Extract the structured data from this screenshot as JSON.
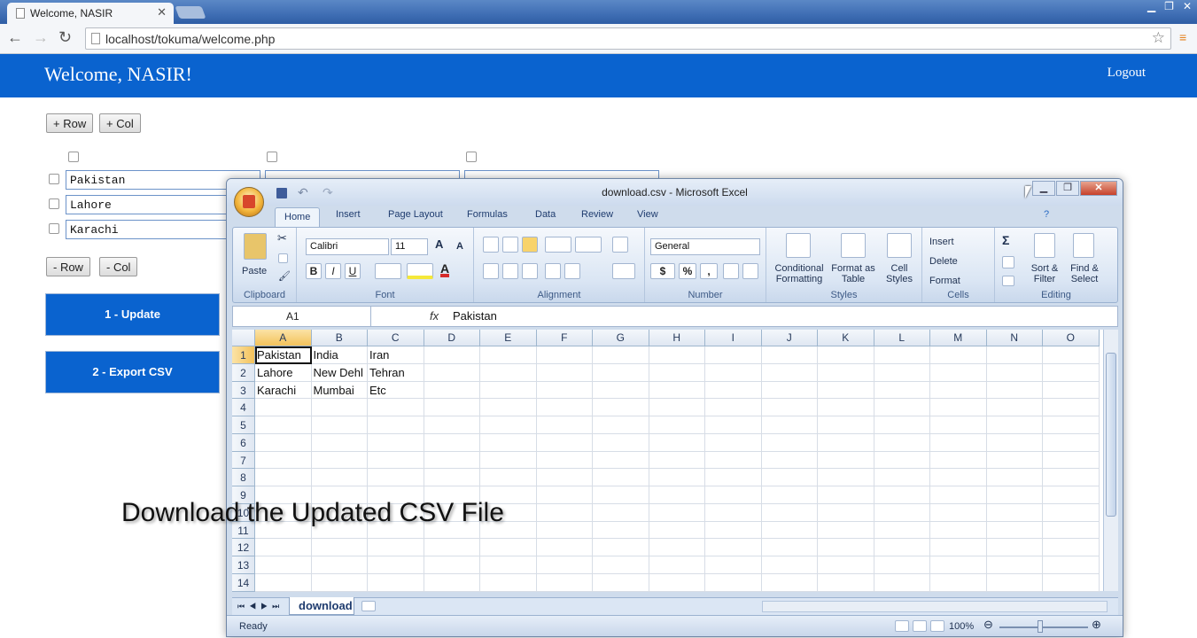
{
  "browser": {
    "tab_title": "Welcome, NASIR",
    "tab_close": "✕",
    "url": "localhost/tokuma/welcome.php",
    "back": "←",
    "forward": "→",
    "reload": "↻",
    "star": "☆",
    "menu": "≡",
    "win_controls": [
      "▁",
      "❐",
      "✕"
    ]
  },
  "page": {
    "welcome": "Welcome, NASIR!",
    "logout": "Logout",
    "add_row": "+ Row",
    "add_col": "+ Col",
    "remove_row": "- Row",
    "remove_col": "- Col",
    "update": "1 - Update",
    "export": "2 - Export CSV",
    "cells": [
      "Pakistan",
      "Lahore",
      "Karachi"
    ]
  },
  "excel": {
    "title": "download.csv - Microsoft Excel",
    "win_controls": [
      "▁",
      "❐",
      "✕"
    ],
    "tabs": [
      "Home",
      "Insert",
      "Page Layout",
      "Formulas",
      "Data",
      "Review",
      "View"
    ],
    "groups": {
      "clipboard": "Clipboard",
      "font": "Font",
      "alignment": "Alignment",
      "number": "Number",
      "styles": "Styles",
      "cells": "Cells",
      "editing": "Editing"
    },
    "paste": "Paste",
    "font_name": "Calibri",
    "font_size": "11",
    "bold": "B",
    "italic": "I",
    "underline": "U",
    "number_format": "General",
    "currency": "$",
    "percent": "%",
    "comma": ",",
    "conditional": "Conditional Formatting",
    "format_table": "Format as Table",
    "cell_styles": "Cell Styles",
    "insert": "Insert",
    "delete": "Delete",
    "format": "Format",
    "sort_filter": "Sort & Filter",
    "find_select": "Find & Select",
    "sigma": "Σ",
    "name_box": "A1",
    "fx": "fx",
    "formula_value": "Pakistan",
    "columns": [
      "A",
      "B",
      "C",
      "D",
      "E",
      "F",
      "G",
      "H",
      "I",
      "J",
      "K",
      "L",
      "M",
      "N",
      "O"
    ],
    "rows": [
      "1",
      "2",
      "3",
      "4",
      "5",
      "6",
      "7",
      "8",
      "9",
      "10",
      "11",
      "12",
      "13",
      "14"
    ],
    "cells": [
      [
        "Pakistan",
        "India",
        "Iran"
      ],
      [
        "Lahore",
        "New Dehl",
        "Tehran"
      ],
      [
        "Karachi",
        "Mumbai",
        "Etc"
      ]
    ],
    "sheet_tab": "download",
    "status": "Ready",
    "zoom": "100%"
  },
  "caption": "Download the Updated CSV File"
}
